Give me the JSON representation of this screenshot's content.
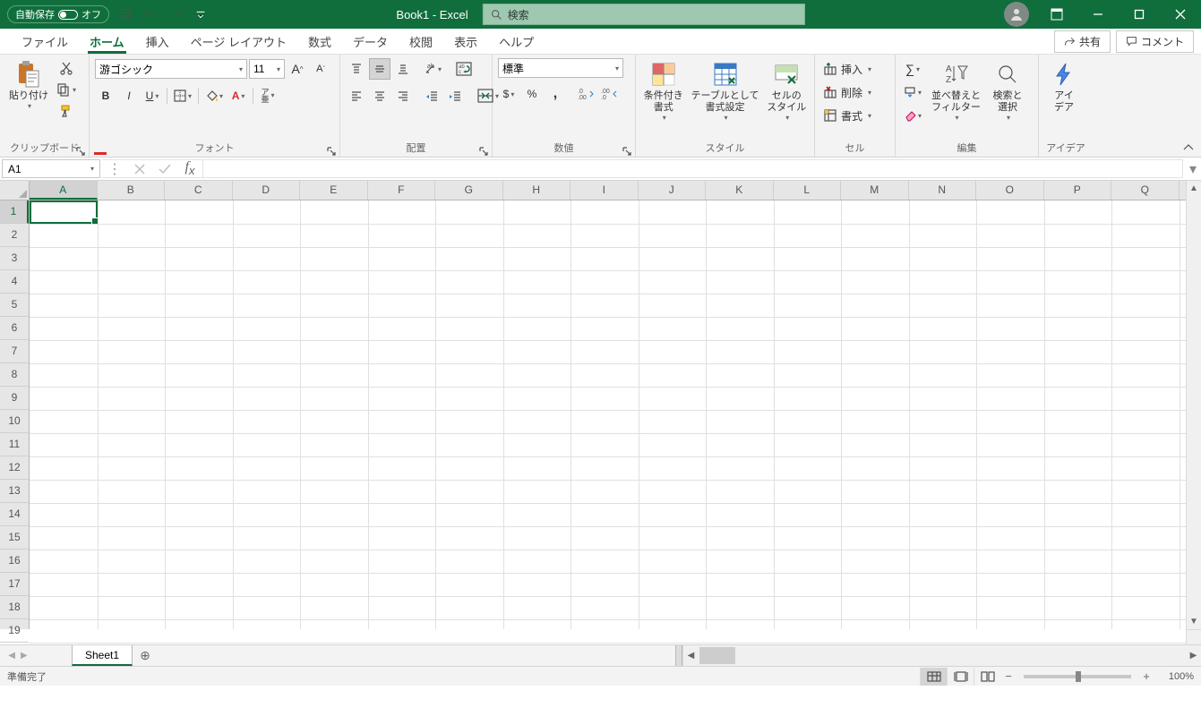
{
  "titlebar": {
    "autosave_label": "自動保存",
    "autosave_state": "オフ",
    "doc_title": "Book1  -  Excel",
    "search_placeholder": "検索"
  },
  "tabs": {
    "file": "ファイル",
    "home": "ホーム",
    "insert": "挿入",
    "page_layout": "ページ レイアウト",
    "formulas": "数式",
    "data": "データ",
    "review": "校閲",
    "view": "表示",
    "help": "ヘルプ",
    "share": "共有",
    "comments": "コメント"
  },
  "ribbon": {
    "clipboard": {
      "paste": "貼り付け",
      "label": "クリップボード"
    },
    "font": {
      "name": "游ゴシック",
      "size": "11",
      "ruby": "ア\n亜",
      "label": "フォント"
    },
    "alignment": {
      "label": "配置"
    },
    "number": {
      "format": "標準",
      "label": "数値"
    },
    "styles": {
      "cond": "条件付き\n書式",
      "table": "テーブルとして\n書式設定",
      "cell": "セルの\nスタイル",
      "label": "スタイル"
    },
    "cells": {
      "insert": "挿入",
      "delete": "削除",
      "format": "書式",
      "label": "セル"
    },
    "editing": {
      "sort": "並べ替えと\nフィルター",
      "find": "検索と\n選択",
      "label": "編集"
    },
    "ideas": {
      "btn": "アイ\nデア",
      "label": "アイデア"
    }
  },
  "formula_bar": {
    "cell_ref": "A1"
  },
  "grid": {
    "columns": [
      "A",
      "B",
      "C",
      "D",
      "E",
      "F",
      "G",
      "H",
      "I",
      "J",
      "K",
      "L",
      "M",
      "N",
      "O",
      "P",
      "Q"
    ],
    "rows": [
      "1",
      "2",
      "3",
      "4",
      "5",
      "6",
      "7",
      "8",
      "9",
      "10",
      "11",
      "12",
      "13",
      "14",
      "15",
      "16",
      "17",
      "18",
      "19"
    ],
    "selected": "A1"
  },
  "sheets": {
    "active": "Sheet1"
  },
  "statusbar": {
    "ready": "準備完了",
    "zoom": "100%"
  }
}
